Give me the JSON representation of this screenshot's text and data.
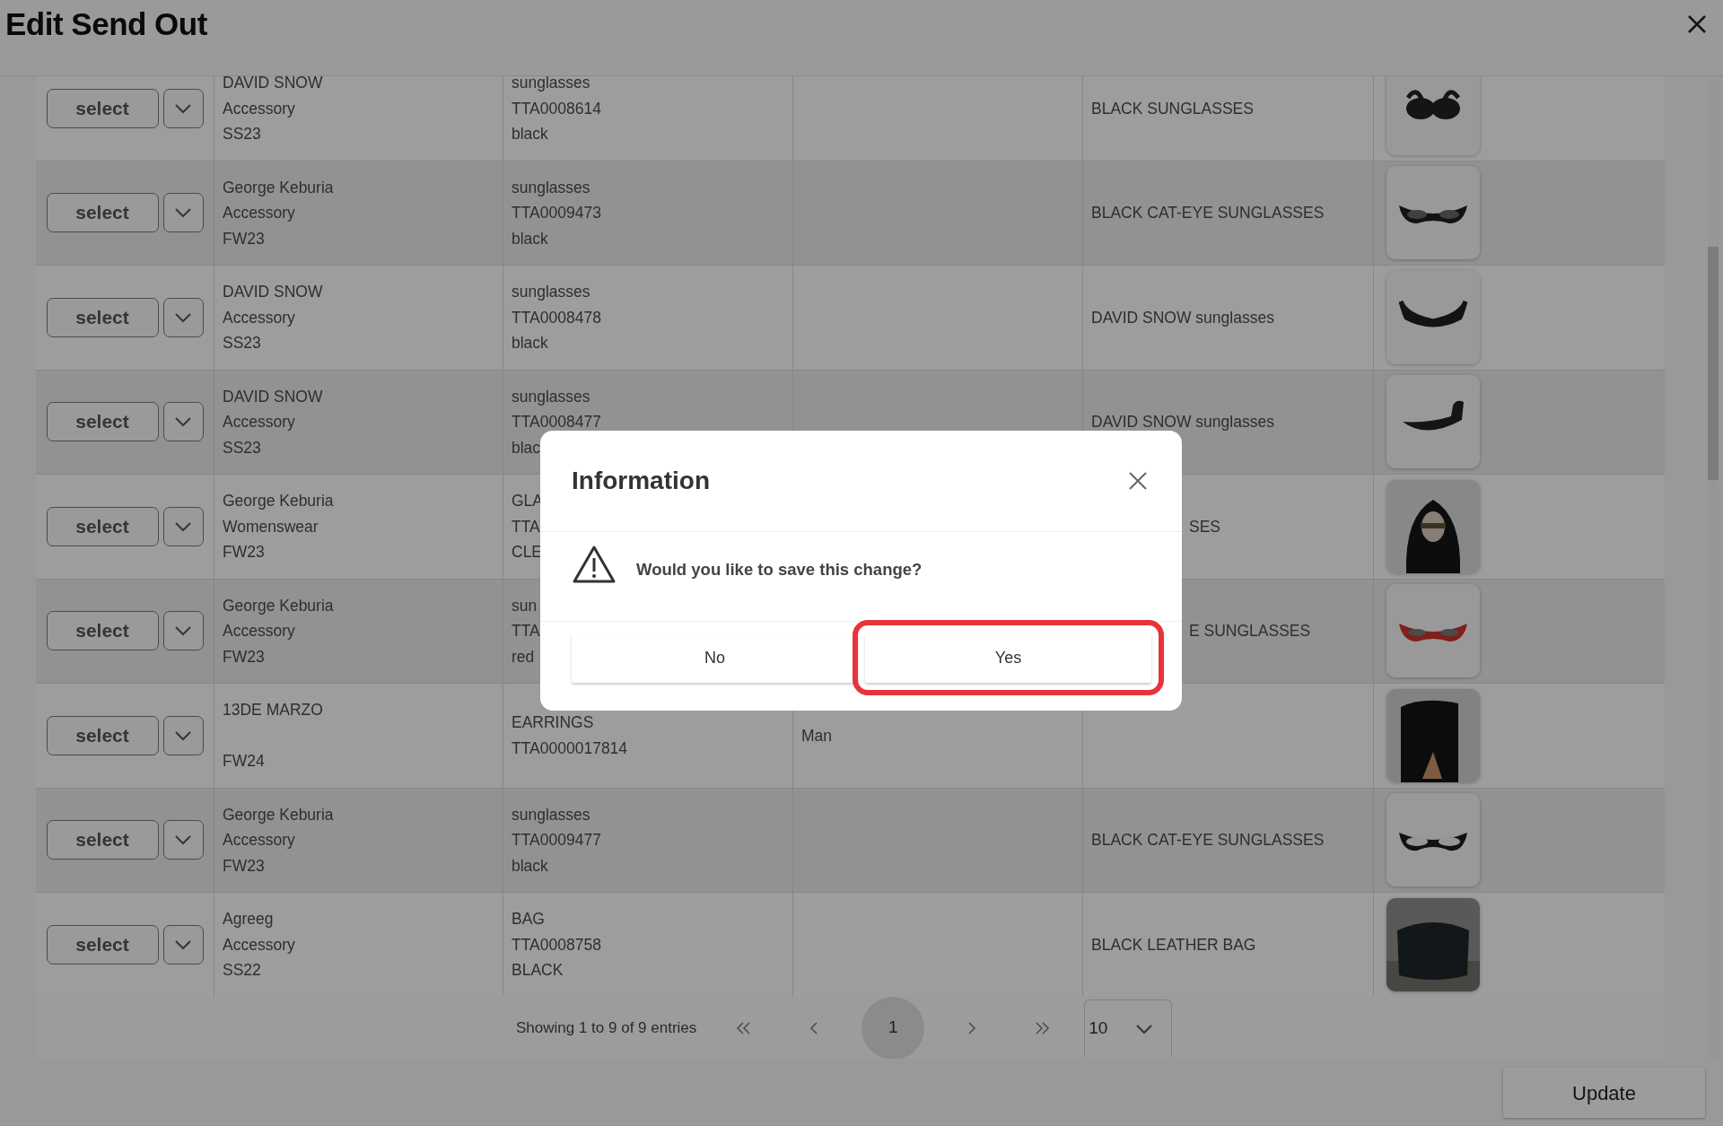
{
  "title": "Edit Send Out",
  "rows": [
    {
      "action": "select",
      "designer": "DAVID SNOW",
      "category": "Accessory",
      "season": "SS23",
      "product": [
        "sunglasses",
        "TTA0008614",
        "black"
      ],
      "description": "BLACK SUNGLASSES",
      "image": {
        "kind": "picture"
      }
    },
    {
      "action": "select",
      "designer": "George Keburia",
      "category": "Accessory",
      "season": "FW23",
      "product": [
        "sunglasses",
        "TTA0009473",
        "black"
      ],
      "description": "BLACK CAT-EYE SUNGLASSES",
      "image": {
        "kind": "picture"
      }
    },
    {
      "action": "select",
      "designer": "DAVID SNOW",
      "category": "Accessory",
      "season": "SS23",
      "product": [
        "sunglasses",
        "TTA0008478",
        "black"
      ],
      "description": "DAVID SNOW sunglasses",
      "image": {
        "kind": "picture"
      }
    },
    {
      "action": "select",
      "designer": "DAVID SNOW",
      "category": "Accessory",
      "season": "SS23",
      "product": [
        "sunglasses",
        "TTA0008477",
        "blac"
      ],
      "description": "DAVID SNOW sunglasses",
      "image": {
        "kind": "picture"
      }
    },
    {
      "action": "select",
      "designer": "George Keburia",
      "category": "Womenswear",
      "season": "FW23",
      "product": [
        "GLA",
        "TTA",
        "CLE"
      ],
      "description": "SES",
      "description_covered": true,
      "image": {
        "kind": "picture"
      }
    },
    {
      "action": "select",
      "designer": "George Keburia",
      "category": "Accessory",
      "season": "FW23",
      "product": [
        "sun",
        "TTA",
        "red"
      ],
      "description": "E SUNGLASSES",
      "description_covered": true,
      "image": {
        "kind": "picture"
      }
    },
    {
      "action": "select",
      "designer": "13DE MARZO",
      "season": "FW24",
      "product": [
        "EARRINGS",
        "TTA0000017814"
      ],
      "gender": "Man",
      "image": {
        "kind": "picture"
      }
    },
    {
      "action": "select",
      "designer": "George Keburia",
      "category": "Accessory",
      "season": "FW23",
      "product": [
        "sunglasses",
        "TTA0009477",
        "black"
      ],
      "description": "BLACK CAT-EYE SUNGLASSES",
      "image": {
        "kind": "picture"
      }
    },
    {
      "action": "select",
      "designer": "Agreeg",
      "category": "Accessory",
      "season": "SS22",
      "product": [
        "BAG",
        "TTA0008758",
        "BLACK"
      ],
      "description": "BLACK LEATHER BAG",
      "image": {
        "kind": "picture"
      }
    }
  ],
  "pagination": {
    "summary": "Showing 1 to 9 of 9 entries",
    "pages": [
      {
        "label": "1",
        "selected": true
      }
    ],
    "page_size": "10"
  },
  "update_button": "Update",
  "modal": {
    "title": "Information",
    "message": "Would you like to save this change?",
    "buttons": [
      {
        "label": "No",
        "highlighted": false
      },
      {
        "label": "Yes",
        "highlighted": true
      }
    ]
  }
}
